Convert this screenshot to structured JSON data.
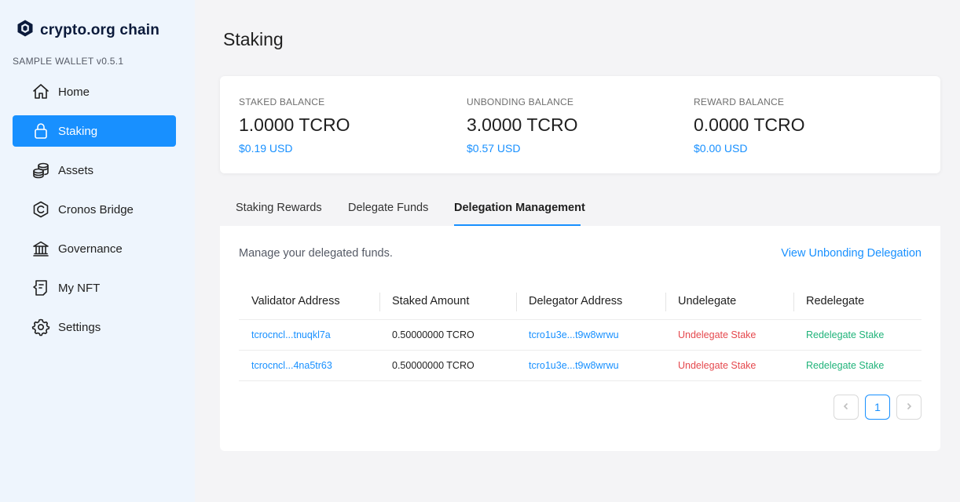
{
  "brand": {
    "name": "crypto.org chain",
    "version": "SAMPLE WALLET v0.5.1"
  },
  "sidebar": {
    "items": [
      {
        "label": "Home",
        "icon": "home-icon"
      },
      {
        "label": "Staking",
        "icon": "lock-icon",
        "active": true
      },
      {
        "label": "Assets",
        "icon": "coins-icon"
      },
      {
        "label": "Cronos Bridge",
        "icon": "cronos-icon"
      },
      {
        "label": "Governance",
        "icon": "bank-icon"
      },
      {
        "label": "My NFT",
        "icon": "nft-icon"
      },
      {
        "label": "Settings",
        "icon": "gear-icon"
      }
    ]
  },
  "page": {
    "title": "Staking"
  },
  "balances": {
    "staked": {
      "label": "STAKED BALANCE",
      "amount": "1.0000 TCRO",
      "usd": "$0.19 USD"
    },
    "unbonding": {
      "label": "UNBONDING BALANCE",
      "amount": "3.0000 TCRO",
      "usd": "$0.57 USD"
    },
    "reward": {
      "label": "REWARD BALANCE",
      "amount": "0.0000 TCRO",
      "usd": "$0.00 USD"
    }
  },
  "tabs": [
    {
      "label": "Staking Rewards"
    },
    {
      "label": "Delegate Funds"
    },
    {
      "label": "Delegation Management",
      "active": true
    }
  ],
  "delegation": {
    "description": "Manage your delegated funds.",
    "view_unbonding": "View Unbonding Delegation",
    "columns": [
      "Validator Address",
      "Staked Amount",
      "Delegator Address",
      "Undelegate",
      "Redelegate"
    ],
    "rows": [
      {
        "validator": "tcrocncl...tnuqkl7a",
        "amount": "0.50000000 TCRO",
        "delegator": "tcro1u3e...t9w8wrwu",
        "undelegate": "Undelegate Stake",
        "redelegate": "Redelegate Stake"
      },
      {
        "validator": "tcrocncl...4na5tr63",
        "amount": "0.50000000 TCRO",
        "delegator": "tcro1u3e...t9w8wrwu",
        "undelegate": "Undelegate Stake",
        "redelegate": "Redelegate Stake"
      }
    ],
    "pagination": {
      "current_page": "1"
    }
  },
  "colors": {
    "accent": "#1890ff",
    "danger": "#e5484d",
    "success": "#20b37a",
    "sidebar_bg": "#eef5fd"
  }
}
